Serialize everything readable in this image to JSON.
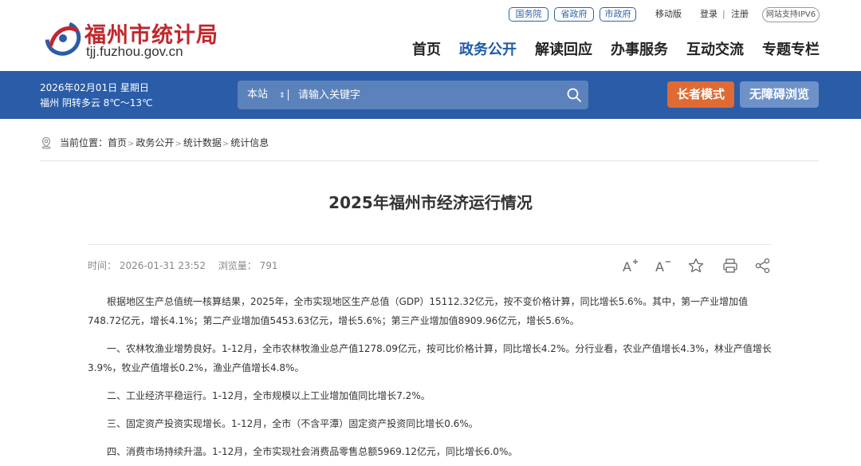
{
  "header": {
    "logo_title": "福州市统计局",
    "logo_domain": "tjj.fuzhou.gov.cn",
    "top_links": {
      "pills": [
        "国务院",
        "省政府",
        "市政府"
      ],
      "mobile": "移动版",
      "login": "登录",
      "separator": "|",
      "register": "注册",
      "ipv6": "网站支持IPV6"
    },
    "nav": [
      {
        "label": "首页"
      },
      {
        "label": "政务公开",
        "active": true
      },
      {
        "label": "解读回应"
      },
      {
        "label": "办事服务"
      },
      {
        "label": "互动交流"
      },
      {
        "label": "专题专栏"
      }
    ]
  },
  "band": {
    "date": "2026年02月01日  星期日",
    "weather": "福州  阴转多云  8℃～13℃",
    "search": {
      "scope": "本站",
      "placeholder": "请输入关键字"
    },
    "elder_mode": "长者模式",
    "accessible": "无障碍浏览"
  },
  "breadcrumb": {
    "label": "当前位置：",
    "items": [
      "首页",
      "政务公开",
      "统计数据",
      "统计信息"
    ],
    "separator": ">"
  },
  "article": {
    "title": "2025年福州市经济运行情况",
    "time": "时间：  2026-01-31 23:52",
    "views": "浏览量：  791",
    "paragraphs": [
      "根据地区生产总值统一核算结果，2025年，全市实现地区生产总值（GDP）15112.32亿元，按不变价格计算，同比增长5.6%。其中，第一产业增加值748.72亿元，增长4.1%；第二产业增加值5453.63亿元，增长5.6%；第三产业增加值8909.96亿元，增长5.6%。",
      "一、农林牧渔业增势良好。1-12月，全市农林牧渔业总产值1278.09亿元，按可比价格计算，同比增长4.2%。分行业看，农业产值增长4.3%，林业产值增长3.9%，牧业产值增长0.2%，渔业产值增长4.8%。",
      "二、工业经济平稳运行。1-12月，全市规模以上工业增加值同比增长7.2%。",
      "三、固定资产投资实现增长。1-12月，全市（不含平潭）固定资产投资同比增长0.6%。",
      "四、消费市场持续升温。1-12月，全市实现社会消费品零售总额5969.12亿元，同比增长6.0%。"
    ]
  },
  "colors": {
    "brand_red": "#c1272d",
    "brand_blue": "#2a5ca8",
    "elder_orange": "#e06a33",
    "accessible_blue": "#6e92c8"
  },
  "icons": [
    "location-icon",
    "font-increase-icon",
    "font-decrease-icon",
    "star-icon",
    "print-icon",
    "share-icon",
    "search-icon",
    "logo-mark-icon"
  ]
}
